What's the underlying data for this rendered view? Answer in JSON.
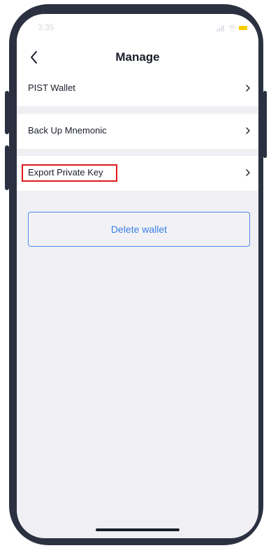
{
  "status_bar": {
    "time": "3:35",
    "battery_color": "#f6cc00"
  },
  "nav": {
    "title": "Manage",
    "back_icon": "chevron-left-icon"
  },
  "menu": {
    "items": [
      {
        "label": "PIST Wallet",
        "icon": "chevron-right-icon"
      },
      {
        "label": "Back Up Mnemonic",
        "icon": "chevron-right-icon"
      },
      {
        "label": "Export Private Key",
        "icon": "chevron-right-icon",
        "highlighted": true
      }
    ]
  },
  "actions": {
    "delete_label": "Delete wallet"
  },
  "colors": {
    "phone_frame": "#2b3140",
    "screen_bg": "#efeff4",
    "accent": "#3a7fe5",
    "highlight": "#e01919"
  }
}
